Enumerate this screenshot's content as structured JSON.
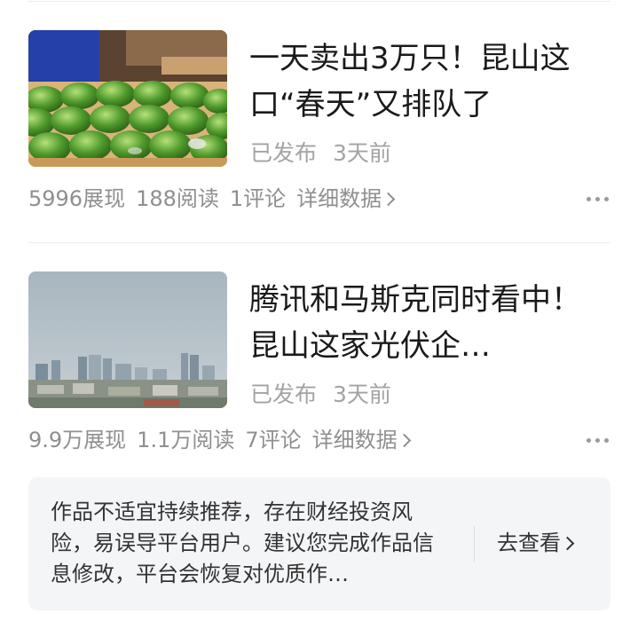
{
  "articles": [
    {
      "title": "一天卖出3万只！昆山这口“春天”又排队了",
      "status": "已发布",
      "time": "3天前",
      "views": "5996展现",
      "reads": "188阅读",
      "comments": "1评论",
      "detail_label": "详细数据",
      "thumbnail_icon": "green-dumplings-photo"
    },
    {
      "title": "腾讯和马斯克同时看中！昆山这家光伏企…",
      "status": "已发布",
      "time": "3天前",
      "views": "9.9万展现",
      "reads": "1.1万阅读",
      "comments": "7评论",
      "detail_label": "详细数据",
      "thumbnail_icon": "city-skyline-photo"
    }
  ],
  "notice": {
    "text": "作品不适宜持续推荐，存在财经投资风险，易误导平台用户。建议您完成作品信息修改，平台会恢复对优质作…",
    "action_label": "去查看"
  },
  "colors": {
    "title": "#1a1a1a",
    "meta": "#a3a3a3",
    "stats": "#8f8f8f",
    "notice_bg": "#f4f5f7"
  }
}
